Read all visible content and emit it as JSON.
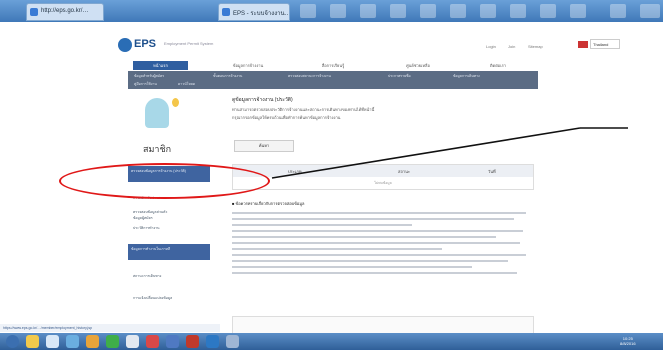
{
  "browser": {
    "address": "http://eps.go.kr/…",
    "tab_title": "EPS - ระบบจ้างงาน…"
  },
  "site": {
    "brand": "EPS",
    "brand_sub": "Employment Permit System",
    "top_links": [
      "Login",
      "Join",
      "Sitemap"
    ],
    "language": "Thailand"
  },
  "nav": {
    "main": [
      "หน้าแรก",
      "ข้อมูลการจ้างงาน",
      "สื่อการเรียนรู้",
      "ศูนย์ช่วยเหลือ",
      "ติดต่อเรา"
    ],
    "sub_row1": [
      "ข้อมูลสำหรับผู้สมัคร",
      "ขั้นตอนการจ้างงาน",
      "ตรวจสอบสถานะการจ้างงาน",
      "ประกาศรายชื่อ",
      "ข้อมูลการเดินทาง"
    ],
    "sub_row2": [
      "คู่มือการใช้งาน",
      "ดาวน์โหลด"
    ]
  },
  "sidebar": {
    "title": "สมาชิก",
    "highlight_item": "ตรวจสอบข้อมูลการจ้างงาน (ประวัติ)",
    "links_a": [
      "การสมัครรับข่าวสาร",
      "ตรวจสอบข้อมูลส่วนตัว",
      "ข้อมูลผู้สมัคร",
      "ประวัติการทำงาน"
    ],
    "highlight_item2": "ข้อมูลการทำงานในเกาหลี",
    "links_b": [
      "สถานะการเดินทาง",
      "การแจ้งเปลี่ยนแปลงข้อมูล"
    ]
  },
  "main": {
    "heading": "ดูข้อมูลการจ้างงาน (ประวัติ)",
    "desc1": "ท่านสามารถตรวจสอบประวัติการจ้างงานและสถานะการเดินทางของท่านได้ที่หน้านี้",
    "desc2": "กรุณากรอกข้อมูลให้ครบถ้วนเพื่อทำการค้นหาข้อมูลการจ้างงาน",
    "search_button": "ค้นหา",
    "table_headers": [
      "ประเภท",
      "สถานะ",
      "วันที่"
    ],
    "table_empty": "ไม่พบข้อมูล",
    "notes_title": "■ ข้อควรทราบเกี่ยวกับการตรวจสอบข้อมูล"
  },
  "statusbar": {
    "text": "https://www.eps.go.kr/…/member/employment_history.jsp"
  },
  "taskbar": {
    "time": "10:25",
    "date": "8/8/2016"
  },
  "colors": {
    "annotation": "#e01818",
    "nav_bar": "#5b6c84",
    "sidebar_highlight": "#3f64a0",
    "taskbar": "#2f5f98"
  }
}
